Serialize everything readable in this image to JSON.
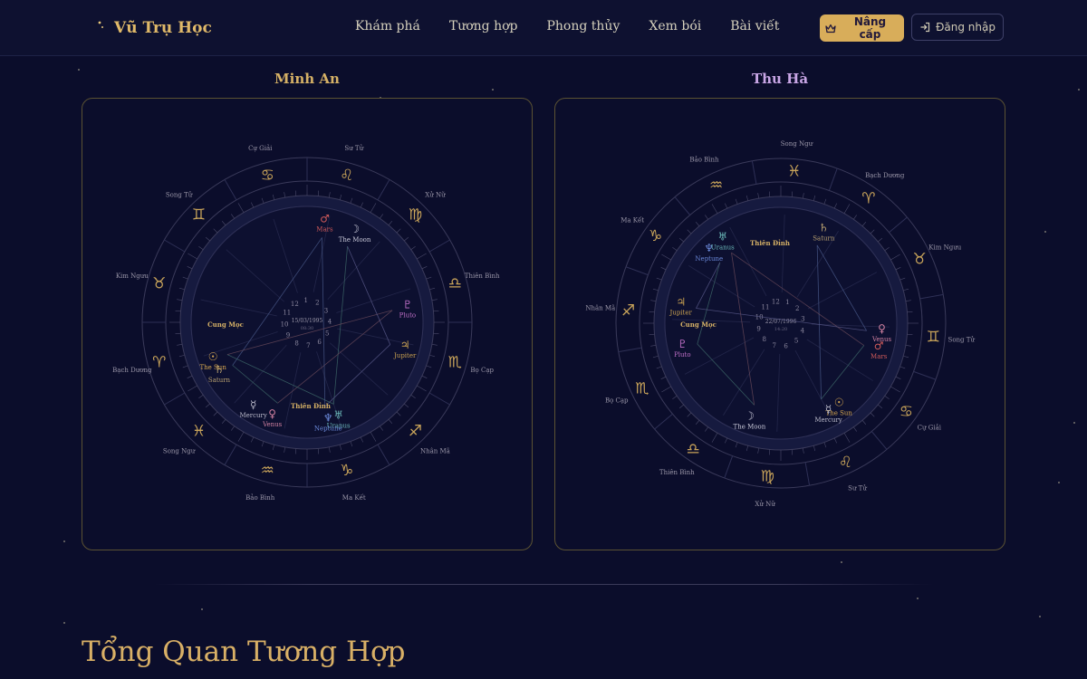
{
  "header": {
    "brand": "Vũ Trụ Học",
    "nav": [
      "Khám phá",
      "Tương hợp",
      "Phong thủy",
      "Xem bói",
      "Bài viết"
    ],
    "upgrade_label": "Nâng cấp",
    "login_label": "Đăng nhập"
  },
  "colors": {
    "accent": "#d8ad5a",
    "background": "#0b0d2b",
    "person_a": "#d6b166",
    "person_b": "#c9a6e6"
  },
  "charts": [
    {
      "person": "Minh An",
      "center_date": "15/03/1995",
      "center_time": "08:30",
      "house_numbers": [
        "1",
        "2",
        "3",
        "4",
        "5",
        "6",
        "7",
        "8",
        "9",
        "10",
        "11",
        "12"
      ],
      "ascendant_label": "Cung Mọc",
      "midheaven_label": "Thiên Đỉnh",
      "signs": [
        "Cự Giải",
        "Sư Tử",
        "Xử Nữ",
        "Thiên Bình",
        "Bọ Cạp",
        "Nhân Mã",
        "Ma Kết",
        "Bảo Bình",
        "Song Ngư",
        "Bạch Dương",
        "Kim Ngưu",
        "Song Tử"
      ],
      "sign_icons": [
        "cancer-icon",
        "leo-icon",
        "virgo-icon",
        "libra-icon",
        "scorpio-icon",
        "sagittarius-icon",
        "capricorn-icon",
        "aquarius-icon",
        "pisces-icon",
        "aries-icon",
        "taurus-icon",
        "gemini-icon"
      ],
      "planets": [
        {
          "name": "Mars",
          "glyph": "♂",
          "color": "#d05a5a"
        },
        {
          "name": "The Moon",
          "glyph": "☽",
          "color": "#c8c8d8"
        },
        {
          "name": "Pluto",
          "glyph": "♇",
          "color": "#c070c8"
        },
        {
          "name": "Jupiter",
          "glyph": "♃",
          "color": "#c8a050"
        },
        {
          "name": "Uranus",
          "glyph": "♅",
          "color": "#6ab8b8"
        },
        {
          "name": "Neptune",
          "glyph": "♆",
          "color": "#6a88d8"
        },
        {
          "name": "Venus",
          "glyph": "♀",
          "color": "#d080a0"
        },
        {
          "name": "Mercury",
          "glyph": "☿",
          "color": "#b8b8c8"
        },
        {
          "name": "Saturn",
          "glyph": "♄",
          "color": "#b8a070"
        },
        {
          "name": "The Sun",
          "glyph": "☉",
          "color": "#d8a850"
        }
      ]
    },
    {
      "person": "Thu Hà",
      "center_date": "22/07/1996",
      "center_time": "14:20",
      "house_numbers": [
        "1",
        "2",
        "3",
        "4",
        "5",
        "6",
        "7",
        "8",
        "9",
        "10",
        "11",
        "12"
      ],
      "ascendant_label": "Cung Mọc",
      "midheaven_label": "Thiên Đỉnh",
      "signs": [
        "Song Ngư",
        "Bạch Dương",
        "Kim Ngưu",
        "Song Tử",
        "Cự Giải",
        "Sư Tử",
        "Xử Nữ",
        "Thiên Bình",
        "Bọ Cạp",
        "Nhân Mã",
        "Ma Kết",
        "Bảo Bình"
      ],
      "sign_icons": [
        "pisces-icon",
        "aries-icon",
        "taurus-icon",
        "gemini-icon",
        "cancer-icon",
        "leo-icon",
        "virgo-icon",
        "libra-icon",
        "scorpio-icon",
        "sagittarius-icon",
        "capricorn-icon",
        "aquarius-icon"
      ],
      "planets": [
        {
          "name": "Saturn",
          "glyph": "♄",
          "color": "#b8a070"
        },
        {
          "name": "Neptune",
          "glyph": "♆",
          "color": "#6a88d8"
        },
        {
          "name": "Uranus",
          "glyph": "♅",
          "color": "#6ab8b8"
        },
        {
          "name": "Jupiter",
          "glyph": "♃",
          "color": "#c8a050"
        },
        {
          "name": "Pluto",
          "glyph": "♇",
          "color": "#c070c8"
        },
        {
          "name": "Venus",
          "glyph": "♀",
          "color": "#d080a0"
        },
        {
          "name": "Mars",
          "glyph": "♂",
          "color": "#d05a5a"
        },
        {
          "name": "The Sun",
          "glyph": "☉",
          "color": "#d8a850"
        },
        {
          "name": "Mercury",
          "glyph": "☿",
          "color": "#b8b8c8"
        },
        {
          "name": "The Moon",
          "glyph": "☽",
          "color": "#c8c8d8"
        }
      ]
    }
  ],
  "section": {
    "title": "Tổng Quan Tương Hợp"
  }
}
